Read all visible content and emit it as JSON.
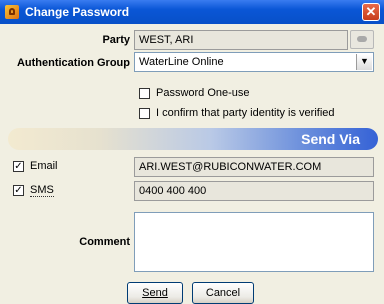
{
  "window": {
    "title": "Change Password",
    "close_glyph": "✕"
  },
  "form": {
    "party_label": "Party",
    "party_value": "WEST, ARI",
    "auth_group_label": "Authentication Group",
    "auth_group_value": "WaterLine Online",
    "password_one_use_label": "Password One-use",
    "password_one_use_checked": false,
    "confirm_identity_label": "I confirm that party identity is verified",
    "confirm_identity_checked": false
  },
  "send_via": {
    "title": "Send Via",
    "email_label": "Email",
    "email_checked": true,
    "email_value": "ARI.WEST@RUBICONWATER.COM",
    "sms_label": "SMS",
    "sms_checked": true,
    "sms_value": "0400 400 400"
  },
  "comment": {
    "label": "Comment",
    "value": ""
  },
  "buttons": {
    "send": "Send",
    "cancel": "Cancel"
  },
  "icons": {
    "app": "key-lock-icon",
    "party_lookup": "lookup-icon",
    "dropdown": "chevron-down-icon"
  }
}
